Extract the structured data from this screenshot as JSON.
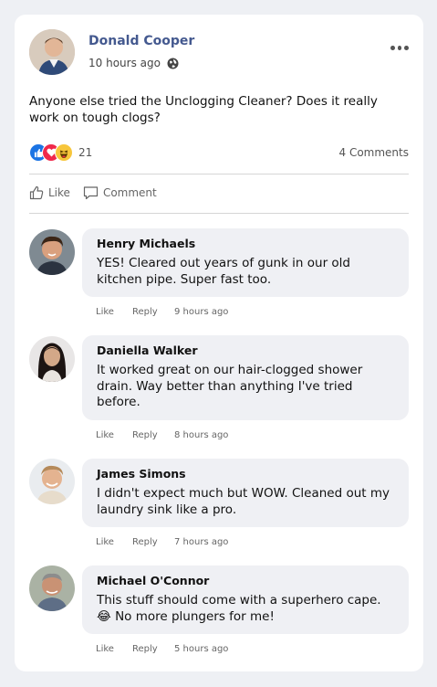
{
  "post": {
    "author": "Donald Cooper",
    "time": "10 hours ago",
    "text": "Anyone else tried the Unclogging Cleaner? Does it really work on tough clogs?",
    "reaction_icons": [
      "like-icon",
      "love-icon",
      "haha-icon"
    ],
    "reaction_count": "21",
    "comments_count": "4 Comments",
    "like_label": "Like",
    "comment_label": "Comment"
  },
  "comments": [
    {
      "name": "Henry Michaels",
      "text": "YES! Cleared out years of gunk in our old kitchen pipe. Super fast too.",
      "like": "Like",
      "reply": "Reply",
      "time": "9 hours ago"
    },
    {
      "name": "Daniella Walker",
      "text": "It worked great on our hair-clogged shower drain. Way better than anything I've tried before.",
      "like": "Like",
      "reply": "Reply",
      "time": "8 hours ago"
    },
    {
      "name": "James Simons",
      "text": "I didn't expect much but WOW. Cleaned out my laundry sink like a pro.",
      "like": "Like",
      "reply": "Reply",
      "time": "7 hours ago"
    },
    {
      "name": "Michael O'Connor",
      "text": "This stuff should come with a superhero cape.",
      "emoji": "😂",
      "text_after_emoji": "No more plungers for me!",
      "like": "Like",
      "reply": "Reply",
      "time": "5 hours ago"
    }
  ],
  "colors": {
    "author": "#44598f",
    "like_blue": "#1b74e4",
    "love_red": "#f0284a",
    "haha_yellow": "#f7c63b",
    "bubble": "#eff0f4"
  }
}
